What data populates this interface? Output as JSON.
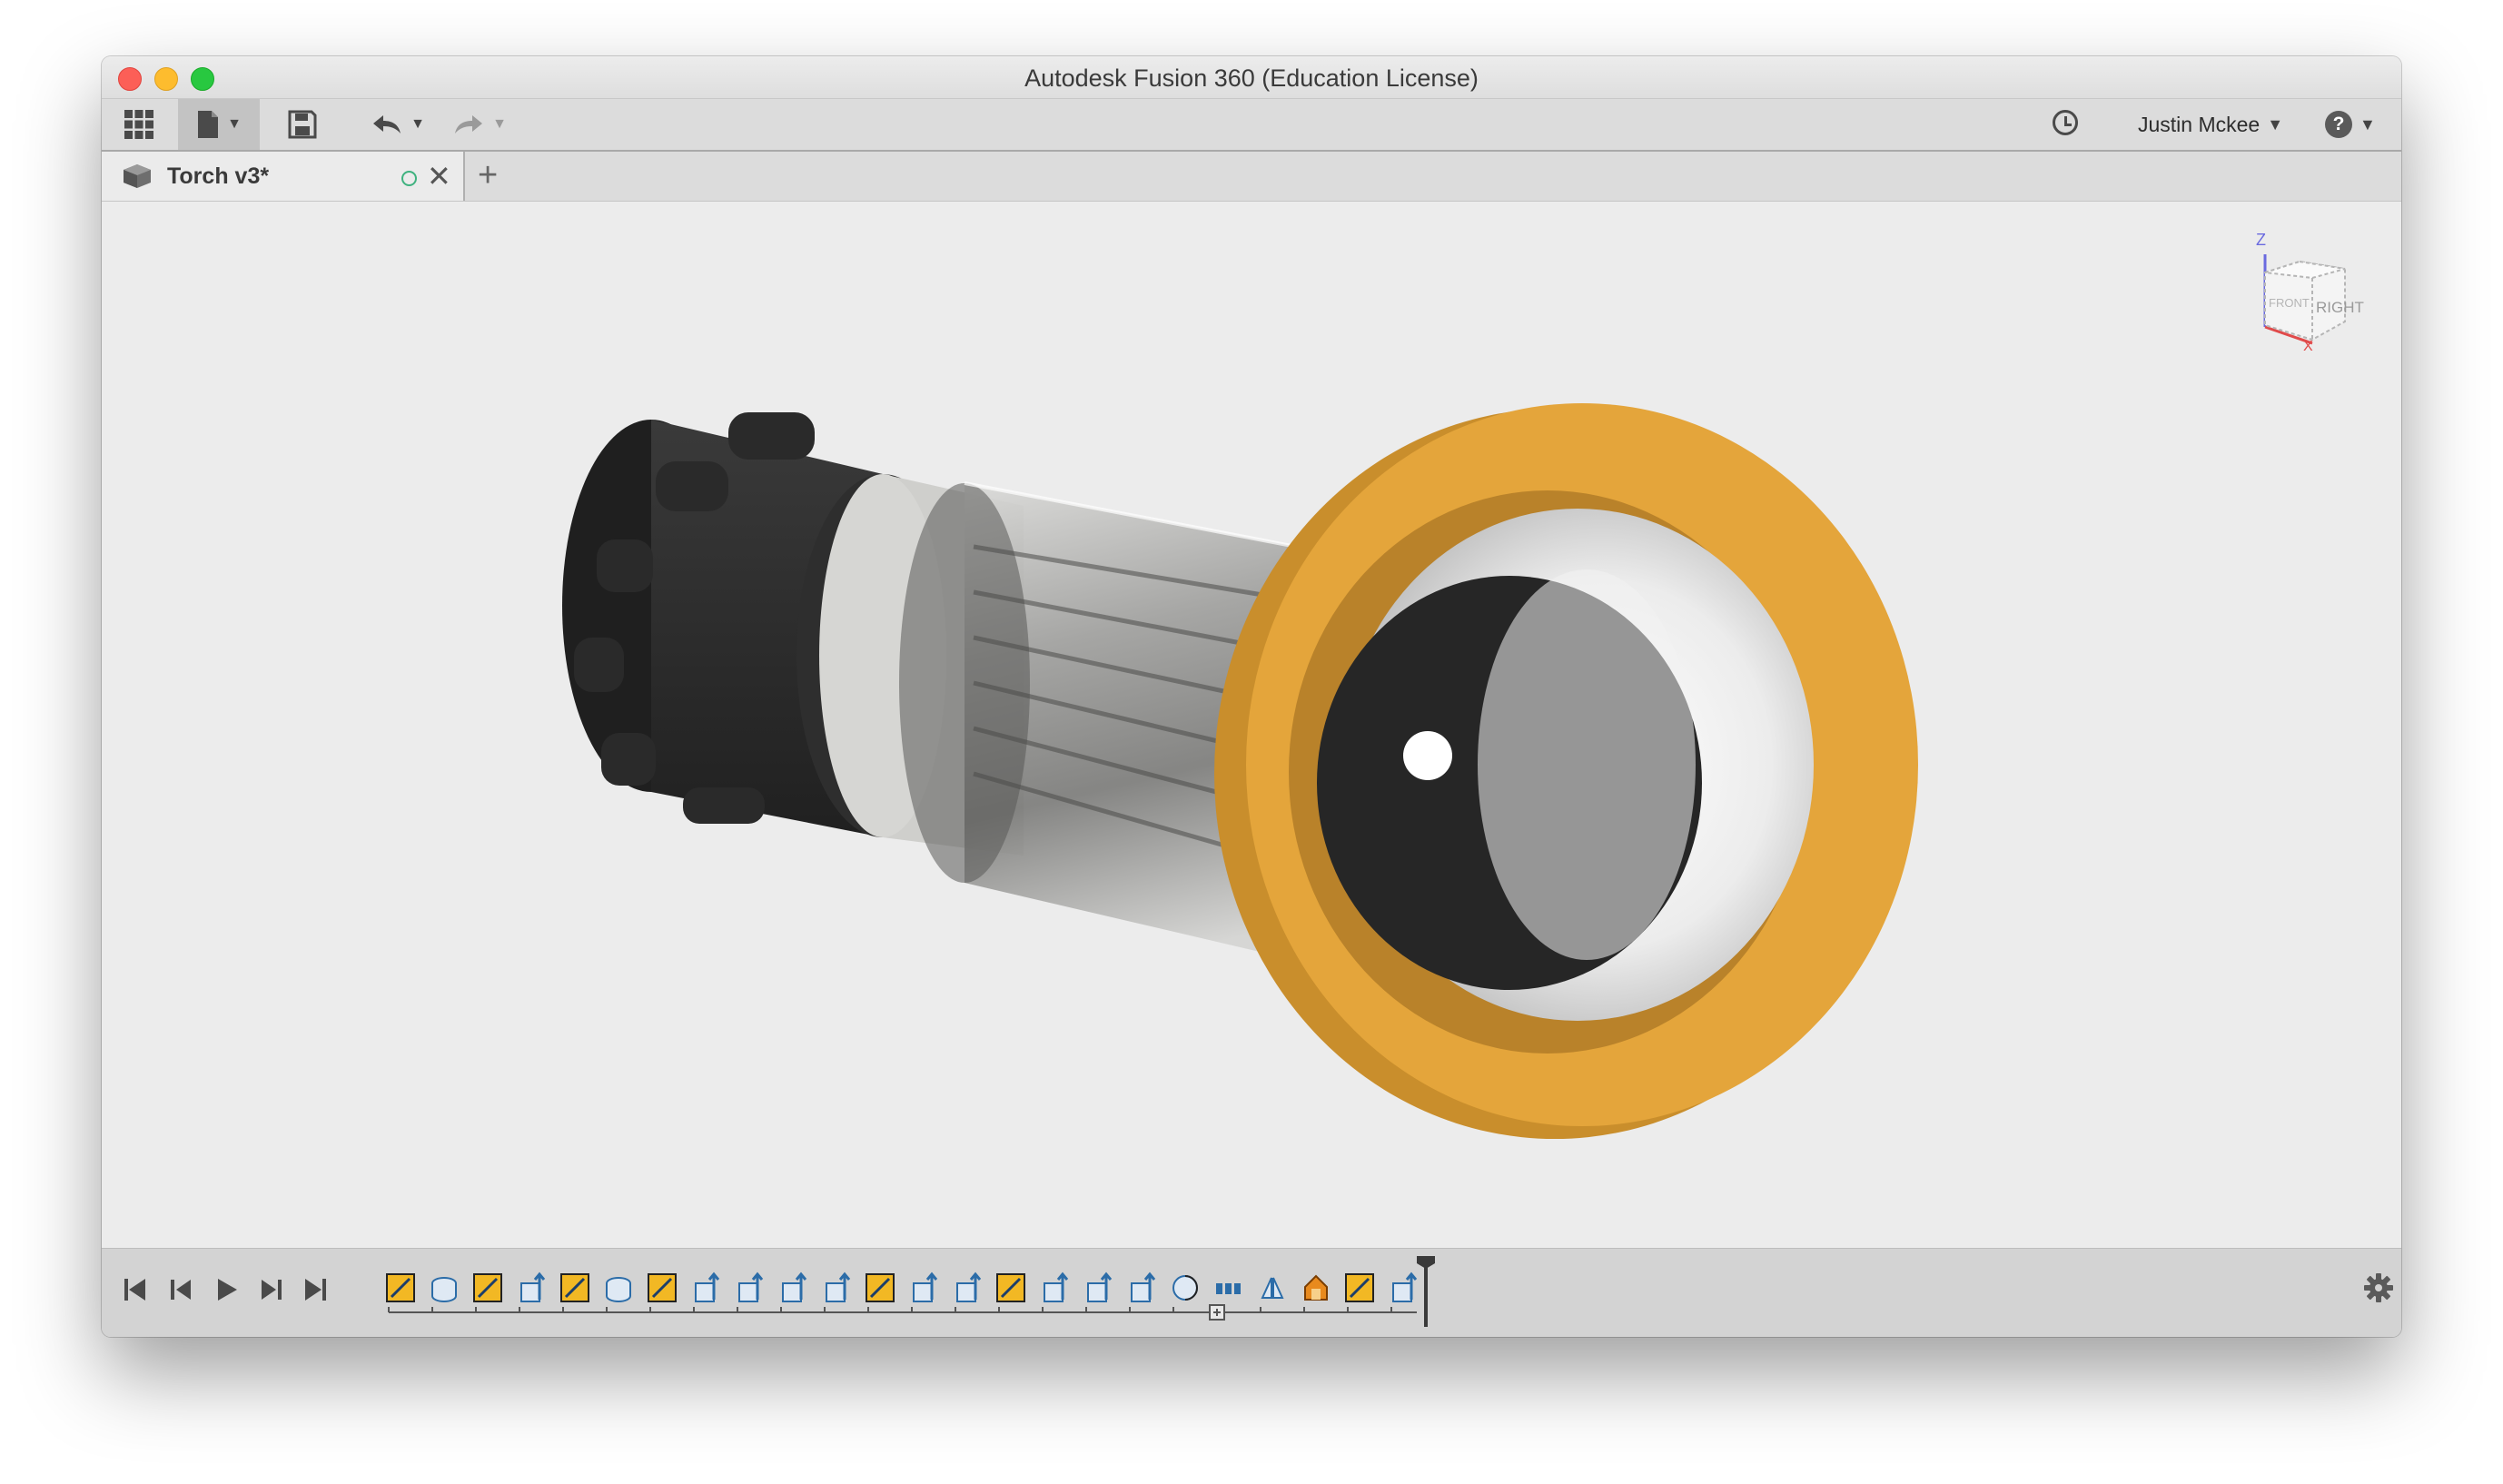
{
  "window": {
    "title": "Autodesk Fusion 360 (Education License)"
  },
  "toolbar": {
    "data_panel_icon": "grid-apps-icon",
    "file_icon": "document-icon",
    "save_icon": "floppy-disk-icon",
    "undo_icon": "undo-arrow-icon",
    "redo_icon": "redo-arrow-icon",
    "job_status_icon": "clock-icon",
    "user_name": "Justin Mckee",
    "help_label": "?"
  },
  "tabs": [
    {
      "label": "Torch v3*",
      "icon": "component-box-icon",
      "status_icon": "status-circle-icon",
      "close_icon": "close-icon"
    }
  ],
  "new_tab_icon": "plus-icon",
  "viewcube": {
    "axis_z": "Z",
    "axis_x": "X",
    "face_right": "RIGHT",
    "face_front": "FRONT"
  },
  "model": {
    "description_icon": "torch-3d-model",
    "colors": {
      "cap": "#2b2b2b",
      "band": "#d2d2cf",
      "tube": "#b8b8b8",
      "bezel": "#e4a53b",
      "lens_dark": "#262626",
      "lens_light": "#f4f4f4"
    }
  },
  "timeline": {
    "controls": [
      "skip-to-start-icon",
      "step-back-icon",
      "play-icon",
      "step-forward-icon",
      "skip-to-end-icon"
    ],
    "features": [
      "sketch",
      "extrude-body",
      "sketch",
      "extrude",
      "sketch",
      "extrude-body",
      "sketch",
      "extrude",
      "extrude",
      "extrude",
      "extrude",
      "sketch",
      "extrude",
      "extrude",
      "sketch",
      "extrude",
      "extrude",
      "extrude",
      "revolve",
      "pattern",
      "mirror",
      "fillet",
      "sketch",
      "extrude"
    ],
    "settings_icon": "gear-icon"
  },
  "colors": {
    "accent_yellow": "#f2b824",
    "timeline_blue": "#2b6ca8"
  }
}
